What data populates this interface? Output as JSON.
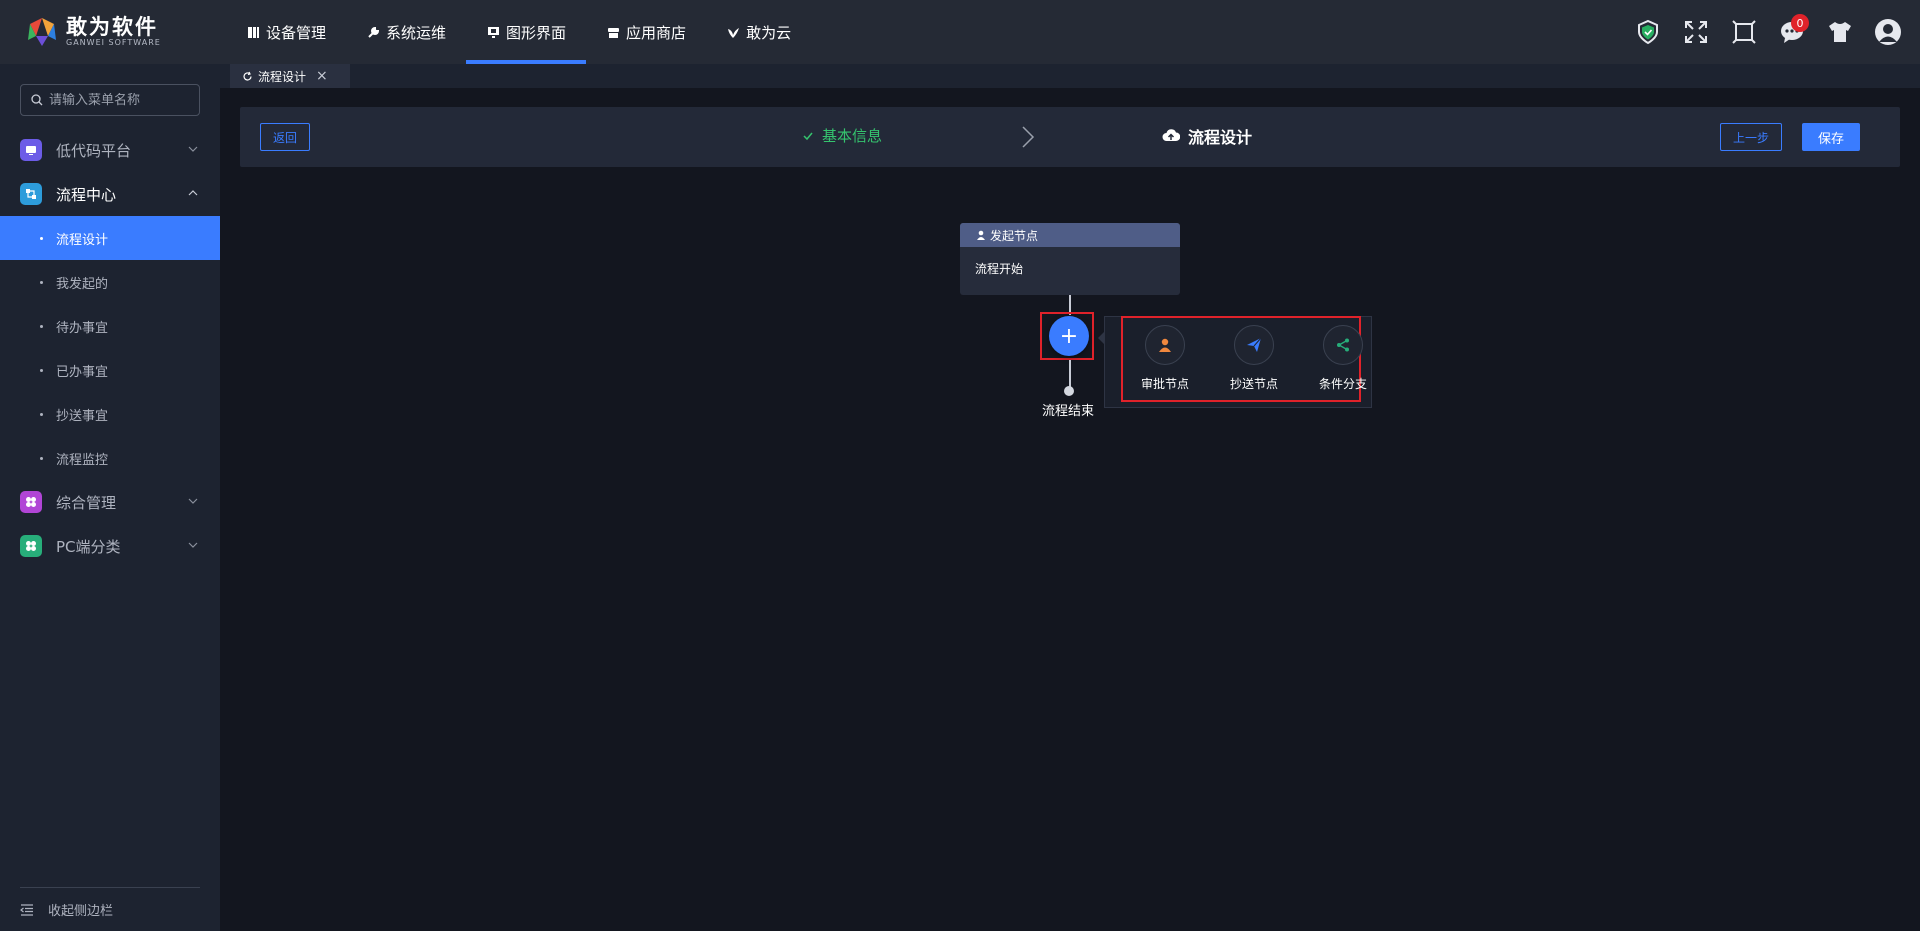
{
  "app": {
    "logo_cn": "敢为软件",
    "logo_en": "GANWEI SOFTWARE"
  },
  "nav": [
    {
      "label": "设备管理",
      "icon": "book-icon"
    },
    {
      "label": "系统运维",
      "icon": "wrench-icon"
    },
    {
      "label": "图形界面",
      "icon": "monitor-icon",
      "active": true
    },
    {
      "label": "应用商店",
      "icon": "store-icon"
    },
    {
      "label": "敢为云",
      "icon": "bird-icon"
    }
  ],
  "header": {
    "message_count": "0"
  },
  "sidebar": {
    "search_placeholder": "请输入菜单名称",
    "groups": [
      {
        "label": "低代码平台",
        "color": "#6c5ce7"
      },
      {
        "label": "流程中心",
        "color": "#2d9cdb"
      },
      {
        "label": "综合管理",
        "color": "#b145d6"
      },
      {
        "label": "PC端分类",
        "color": "#27ae7a"
      }
    ],
    "flow_items": [
      "流程设计",
      "我发起的",
      "待办事宜",
      "已办事宜",
      "抄送事宜",
      "流程监控"
    ],
    "collapse_label": "收起侧边栏"
  },
  "tabs": [
    {
      "label": "流程设计"
    }
  ],
  "steps": {
    "back_label": "返回",
    "step1": "基本信息",
    "step2": "流程设计",
    "prev_label": "上一步",
    "save_label": "保存"
  },
  "flow": {
    "start_title": "发起节点",
    "start_body": "流程开始",
    "add_symbol": "+",
    "end_label": "流程结束",
    "options": [
      {
        "label": "审批节点",
        "icon": "user-icon",
        "color": "#f0883e"
      },
      {
        "label": "抄送节点",
        "icon": "paper-plane-icon",
        "color": "#3a7cff"
      },
      {
        "label": "条件分支",
        "icon": "share-icon",
        "color": "#27ae7a"
      }
    ]
  },
  "colors": {
    "accent": "#3a7cff",
    "success": "#35c46e",
    "danger": "#e0222a"
  }
}
